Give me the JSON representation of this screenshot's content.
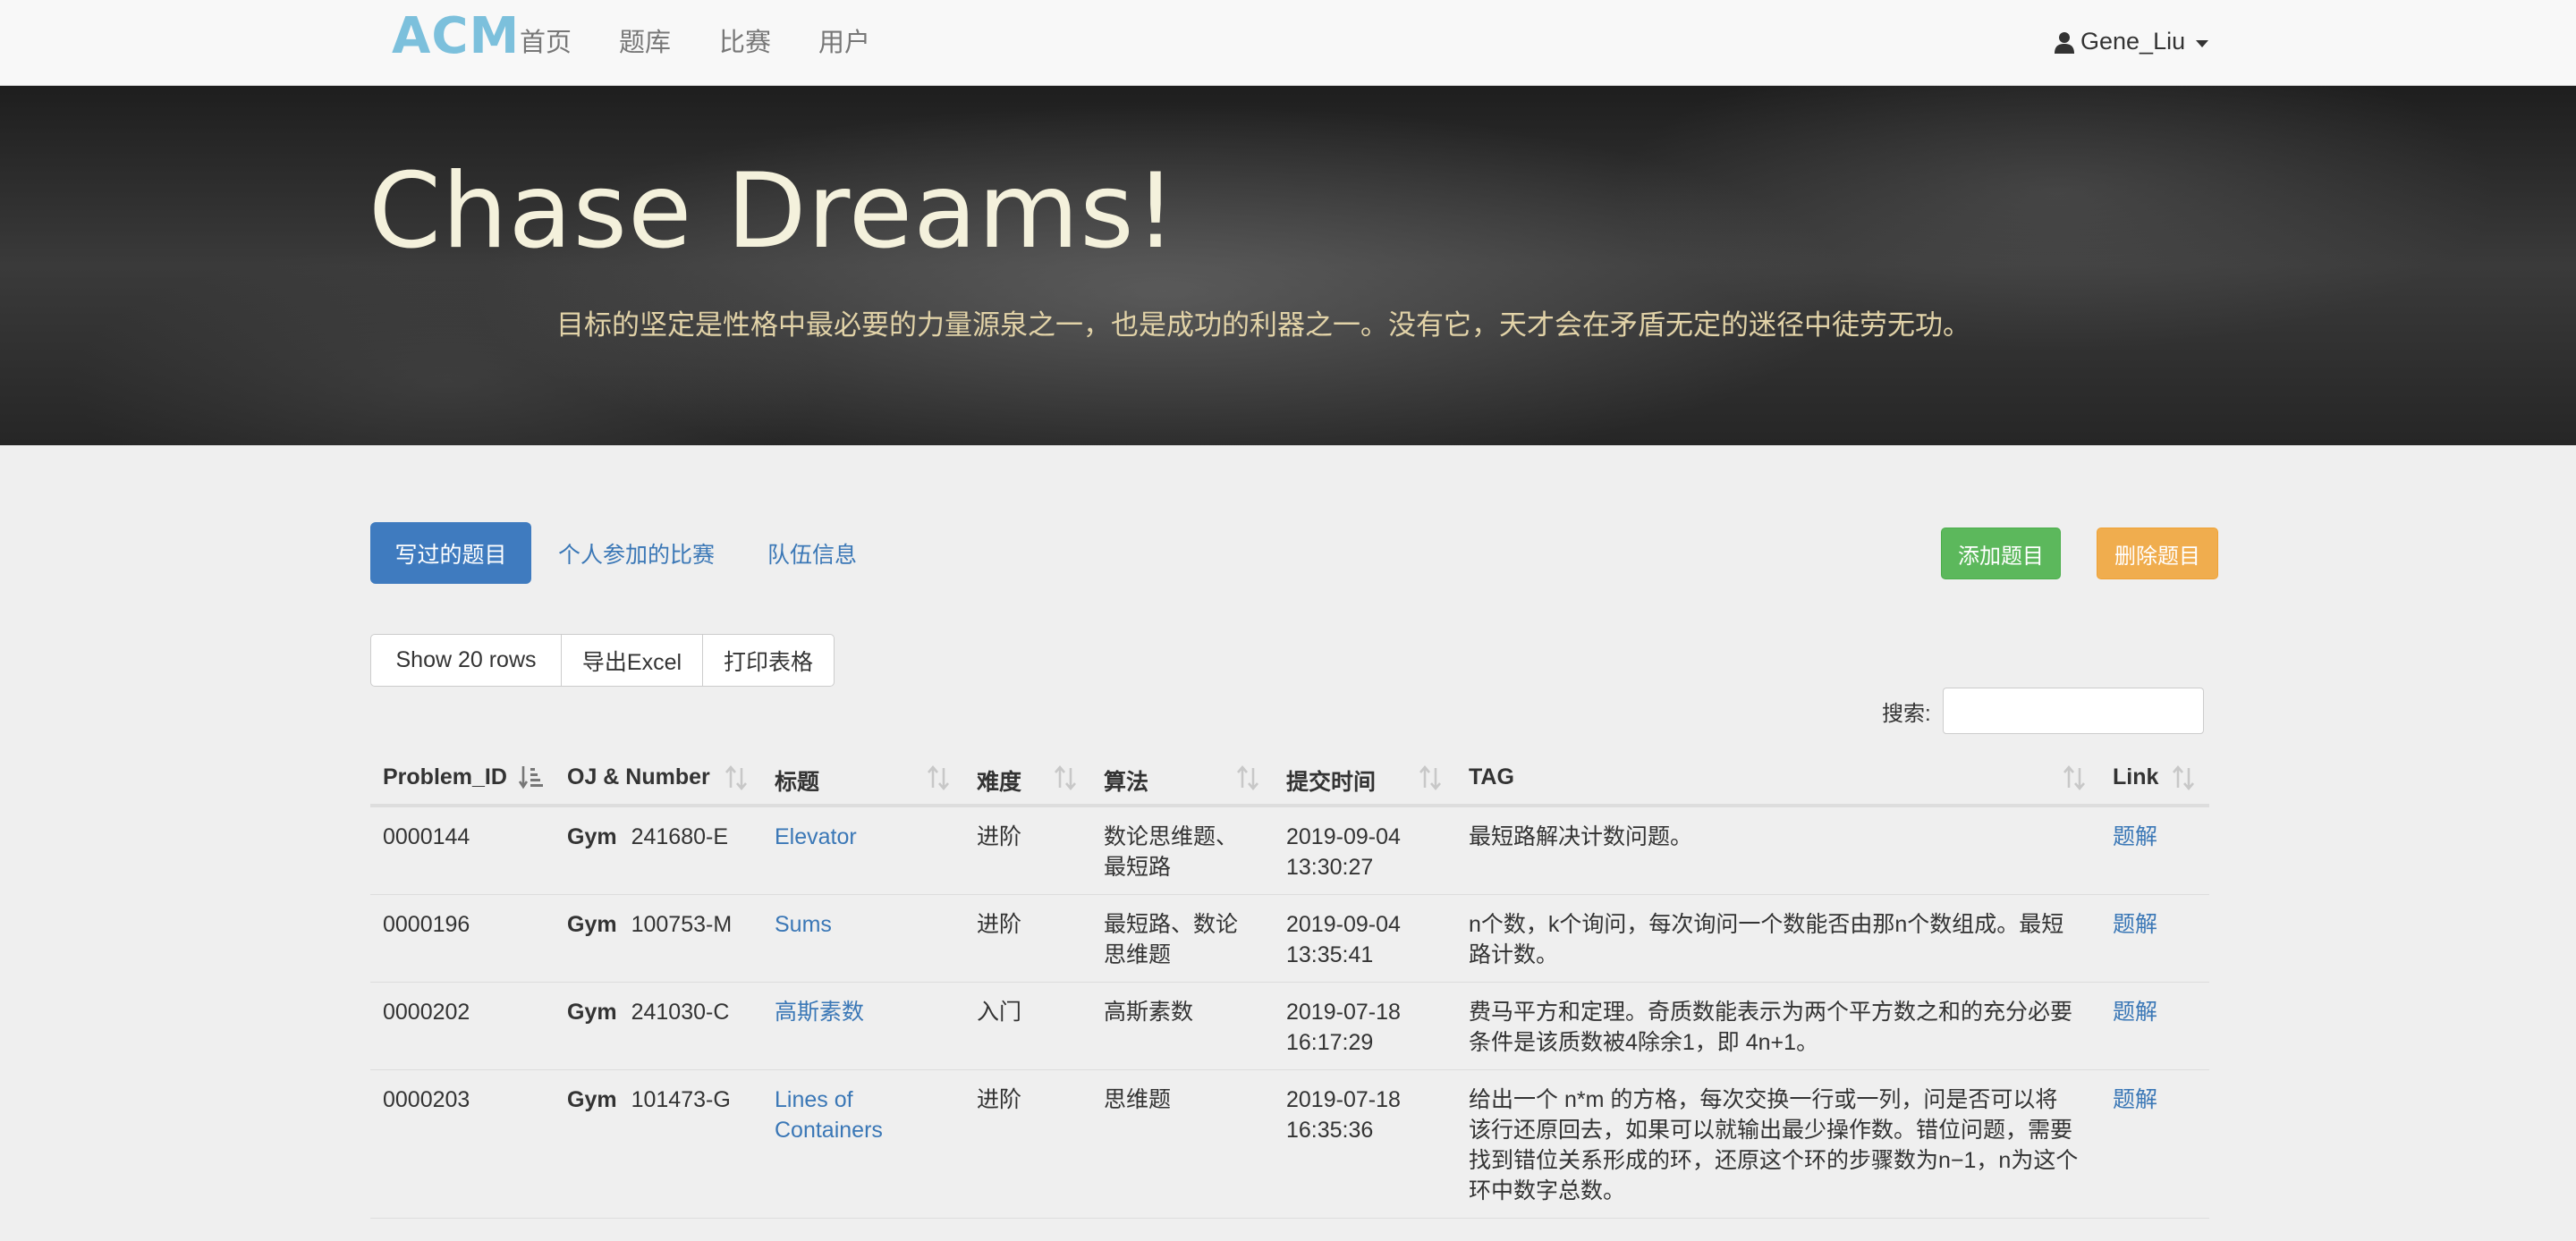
{
  "navbar": {
    "brand": "ACM",
    "links": [
      "首页",
      "题库",
      "比赛",
      "用户"
    ],
    "username": "Gene_Liu"
  },
  "hero": {
    "title": "Chase Dreams!",
    "subtitle": "目标的坚定是性格中最必要的力量源泉之一，也是成功的利器之一。没有它，天才会在矛盾无定的迷径中徒劳无功。"
  },
  "tabs": {
    "active": "写过的题目",
    "contests": "个人参加的比赛",
    "team": "队伍信息"
  },
  "actions": {
    "add": "添加题目",
    "delete": "删除题目"
  },
  "toolbar": {
    "show_rows": "Show 20 rows",
    "export": "导出Excel",
    "print": "打印表格"
  },
  "search": {
    "label": "搜索:",
    "value": ""
  },
  "table": {
    "headers": [
      "Problem_ID",
      "OJ & Number",
      "标题",
      "难度",
      "算法",
      "提交时间",
      "TAG",
      "Link"
    ],
    "rows": [
      {
        "id": "0000144",
        "oj": "Gym",
        "num": "241680-E",
        "title": "Elevator",
        "level": "进阶",
        "algo1": "数论思维题、",
        "algo2": "最短路",
        "date": "2019-09-04",
        "time": "13:30:27",
        "tag": [
          "最短路解决计数问题。"
        ],
        "link": "题解"
      },
      {
        "id": "0000196",
        "oj": "Gym",
        "num": "100753-M",
        "title": "Sums",
        "level": "进阶",
        "algo1": "最短路、数论",
        "algo2": "思维题",
        "date": "2019-09-04",
        "time": "13:35:41",
        "tag": [
          "n个数，k个询问，每次询问一个数能否由那n个数组成。最短",
          "路计数。"
        ],
        "link": "题解"
      },
      {
        "id": "0000202",
        "oj": "Gym",
        "num": "241030-C",
        "title": "高斯素数",
        "level": "入门",
        "algo1": "高斯素数",
        "algo2": "",
        "date": "2019-07-18",
        "time": "16:17:29",
        "tag": [
          "费马平方和定理。奇质数能表示为两个平方数之和的充分必要",
          "条件是该质数被4除余1，即 4n+1。"
        ],
        "link": "题解"
      },
      {
        "id": "0000203",
        "oj": "Gym",
        "num": "101473-G",
        "title": "Lines of",
        "title2": "Containers",
        "level": "进阶",
        "algo1": "思维题",
        "algo2": "",
        "date": "2019-07-18",
        "time": "16:35:36",
        "tag": [
          "给出一个 n*m 的方格，每次交换一行或一列，问是否可以将",
          "该行还原回去，如果可以就输出最少操作数。错位问题，需要",
          "找到错位关系形成的环，还原这个环的步骤数为n−1，n为这个",
          "环中数字总数。"
        ],
        "link": "题解"
      }
    ]
  }
}
